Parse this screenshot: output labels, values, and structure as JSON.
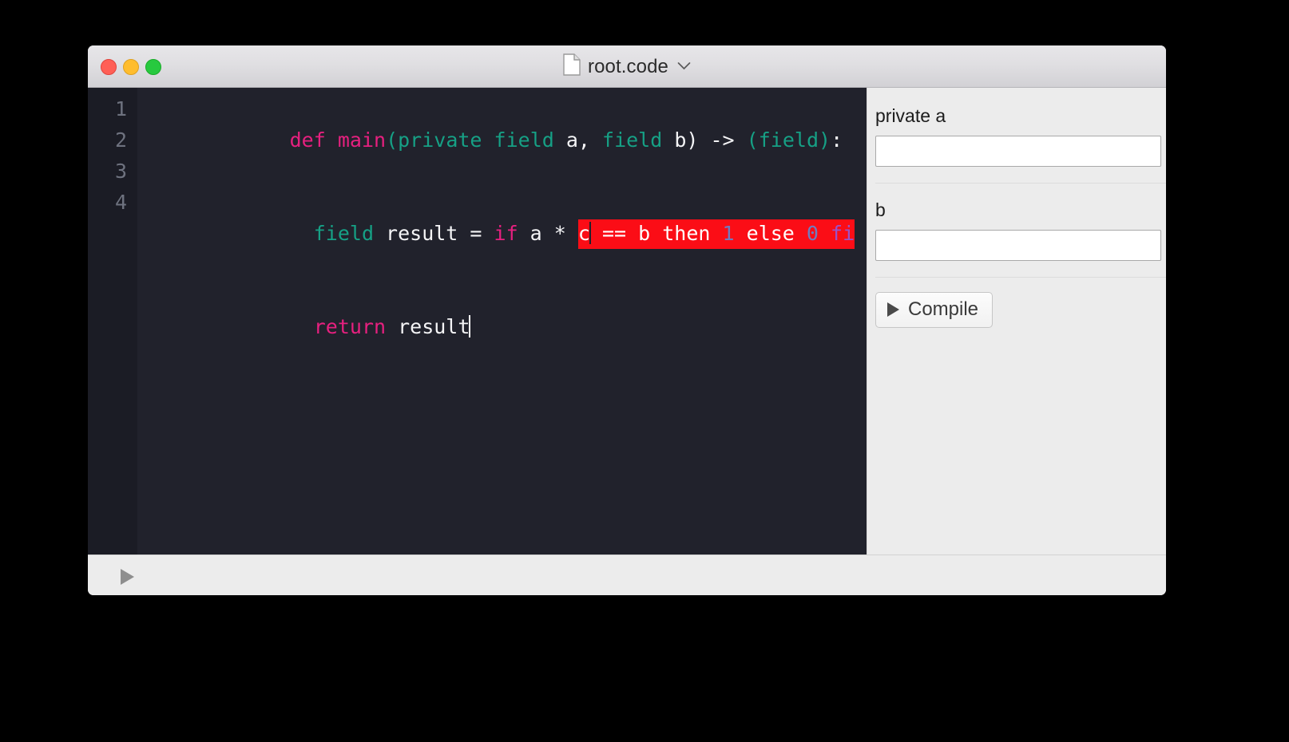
{
  "window": {
    "title": "root.code",
    "title_icon": "document-icon",
    "chevron_icon": "chevron-down-icon",
    "traffic_lights": [
      {
        "name": "close",
        "color": "#ff5f56"
      },
      {
        "name": "minimize",
        "color": "#ffbd2e"
      },
      {
        "name": "zoom",
        "color": "#27c93f"
      }
    ]
  },
  "editor": {
    "background": "#21222c",
    "gutter_background": "#1b1c25",
    "line_numbers": [
      "1",
      "2",
      "3",
      "4"
    ],
    "error_highlight_color": "#fb0d16",
    "lines": [
      {
        "number": "1",
        "tokens": [
          {
            "text": "def ",
            "kind": "keyword"
          },
          {
            "text": "main",
            "kind": "keyword"
          },
          {
            "text": "(",
            "kind": "punct"
          },
          {
            "text": "private field ",
            "kind": "type"
          },
          {
            "text": "a",
            "kind": "plain"
          },
          {
            "text": ", ",
            "kind": "plain"
          },
          {
            "text": "field ",
            "kind": "type"
          },
          {
            "text": "b",
            "kind": "plain"
          },
          {
            "text": ")",
            "kind": "plain"
          },
          {
            "text": " -> ",
            "kind": "plain"
          },
          {
            "text": "(",
            "kind": "punct"
          },
          {
            "text": "field",
            "kind": "type"
          },
          {
            "text": ")",
            "kind": "punct"
          },
          {
            "text": ":",
            "kind": "plain"
          }
        ]
      },
      {
        "number": "2",
        "tokens": [
          {
            "text": "  ",
            "kind": "plain"
          },
          {
            "text": "field",
            "kind": "type"
          },
          {
            "text": " result = ",
            "kind": "plain"
          },
          {
            "text": "if",
            "kind": "keyword"
          },
          {
            "text": " a * ",
            "kind": "plain"
          },
          {
            "text": "c",
            "kind": "highlight-start"
          },
          {
            "text": "caret",
            "kind": "caret-dark"
          },
          {
            "text": " == b then ",
            "kind": "highlight"
          },
          {
            "text": "1",
            "kind": "highlight-num"
          },
          {
            "text": " else ",
            "kind": "highlight"
          },
          {
            "text": "0",
            "kind": "highlight-num"
          },
          {
            "text": " ",
            "kind": "highlight"
          },
          {
            "text": "fi",
            "kind": "highlight-fi"
          }
        ]
      },
      {
        "number": "3",
        "tokens": [
          {
            "text": "  ",
            "kind": "plain"
          },
          {
            "text": "return",
            "kind": "keyword"
          },
          {
            "text": " result",
            "kind": "plain"
          },
          {
            "text": "caret",
            "kind": "caret-light"
          }
        ]
      },
      {
        "number": "4",
        "tokens": []
      }
    ],
    "raw_text": [
      "def main(private field a, field b) -> (field):",
      "  field result = if a * c == b then 1 else 0 fi",
      "  return result",
      ""
    ]
  },
  "panel": {
    "fields": [
      {
        "label": "private a",
        "value": "",
        "placeholder": ""
      },
      {
        "label": "b",
        "value": "",
        "placeholder": ""
      }
    ],
    "compile_button": {
      "label": "Compile",
      "icon": "play-triangle-icon"
    }
  },
  "statusbar": {
    "play_icon": "play-triangle-icon"
  }
}
